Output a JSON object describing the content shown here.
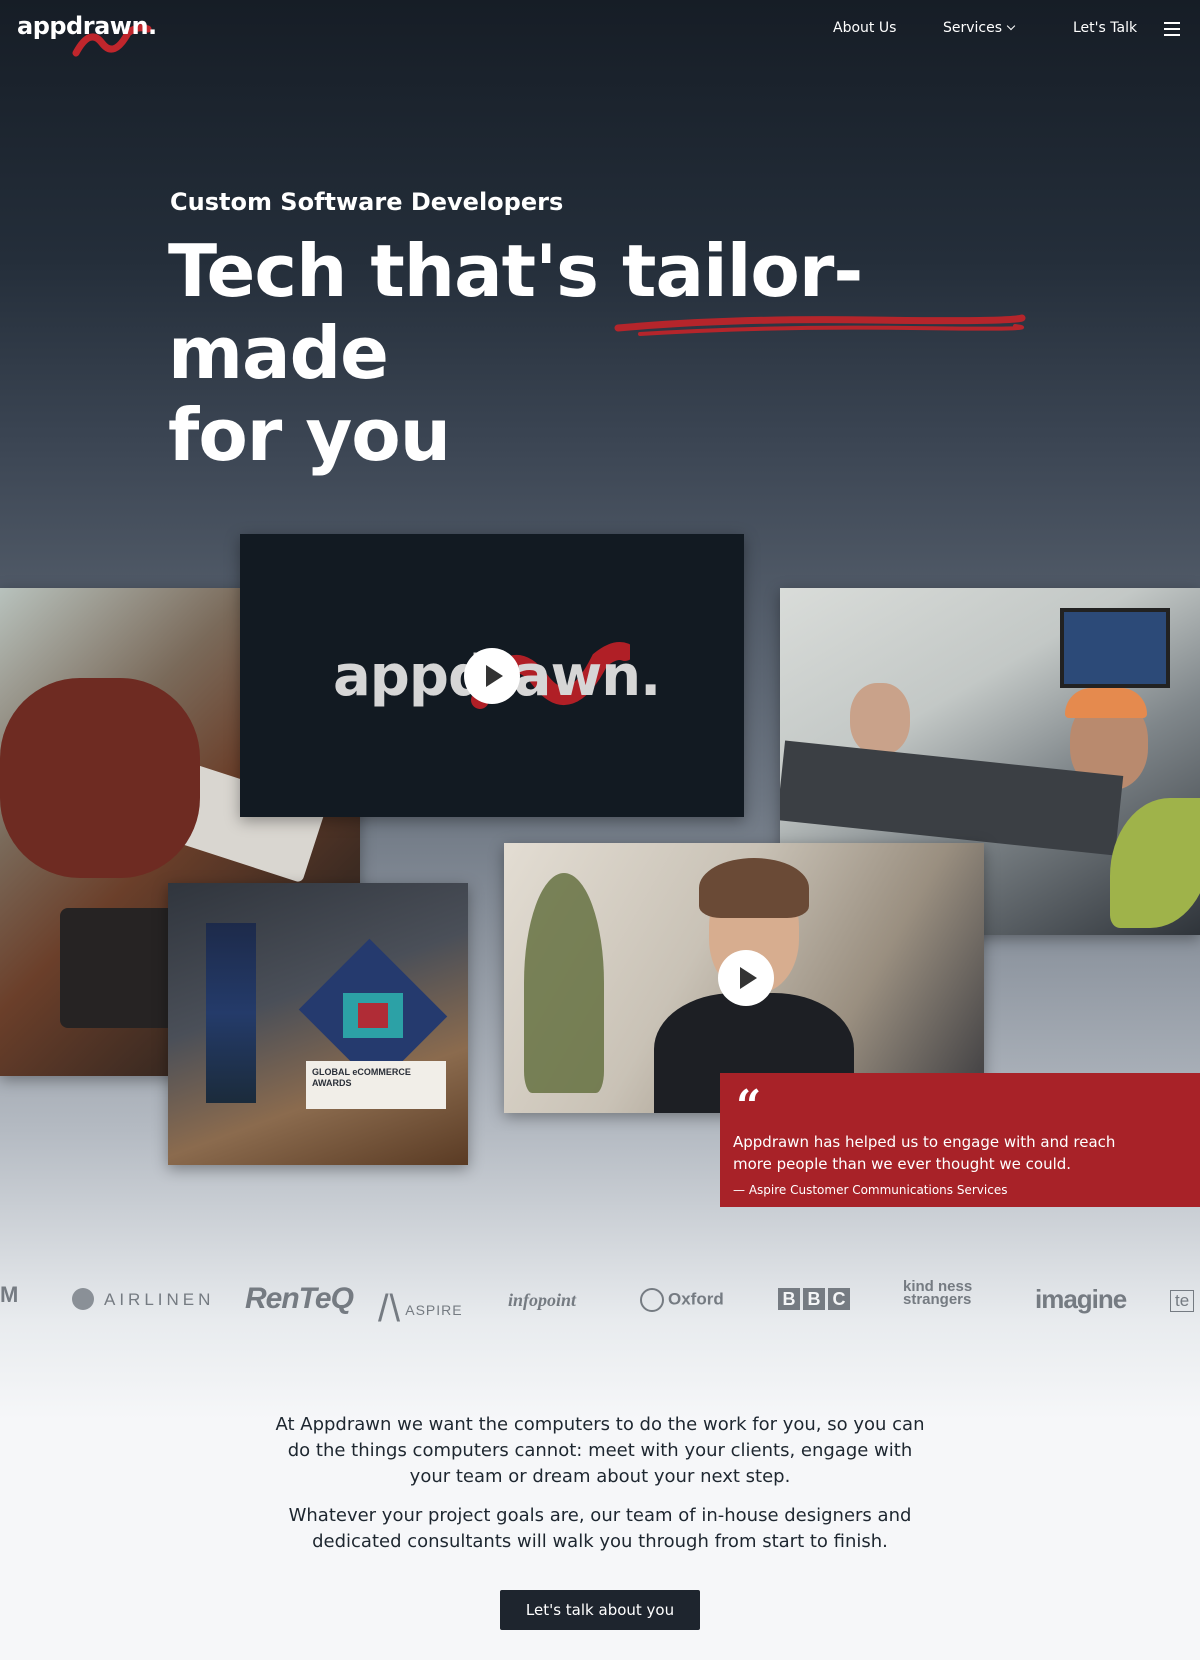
{
  "header": {
    "logo": "appdrawn.",
    "nav": {
      "about": "About Us",
      "services": "Services",
      "talk": "Let's Talk"
    }
  },
  "hero": {
    "eyebrow": "Custom Software Developers",
    "headline_part1": "Tech that's",
    "headline_highlight": "tailor-made",
    "headline_part2": "for you"
  },
  "video": {
    "logo": "appdrawn."
  },
  "award": {
    "label": "GLOBAL eCOMMERCE AWARDS"
  },
  "quote": {
    "mark": "“",
    "text": "Appdrawn has helped us to engage with and reach more people than we ever thought we could.",
    "cite": "— Aspire Customer Communications Services"
  },
  "clients": {
    "m": "M",
    "airlinen": "AIRLINEN",
    "renteq": "RenTeQ",
    "aspire": "ASPIRE",
    "infopoint": "infopoint",
    "oxford": "Oxford",
    "bbc": [
      "B",
      "B",
      "C"
    ],
    "kindness": "kind ness strangers",
    "imagine": "imagine",
    "te": "te"
  },
  "intro": {
    "p1": "At Appdrawn we want the computers to do the work for you, so you can do the things computers cannot: meet with your clients, engage with your team or dream about your next step.",
    "p2": "Whatever your project goals are, our team of in-house designers and dedicated consultants will walk you through from start to finish.",
    "cta": "Let's talk about you"
  },
  "colors": {
    "brand_red": "#a82228",
    "dark": "#1e252e"
  },
  "icons": {
    "menu": "hamburger-icon",
    "play": "play-icon",
    "dropdown": "chevron-down-icon"
  }
}
